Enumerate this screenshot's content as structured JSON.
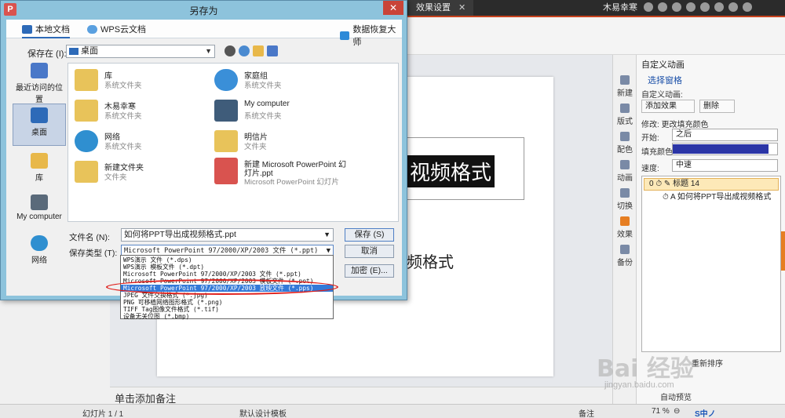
{
  "app": {
    "doc_tab": "效果设置",
    "user": "木易幸寒",
    "canvas_head": [
      "ㅊ",
      "✕",
      "⬚"
    ],
    "slide": {
      "title_text": "视频格式",
      "subtitle_text": "频格式"
    },
    "notes_placeholder": "单击添加备注",
    "status": {
      "slide": "幻灯片 1 / 1",
      "template": "默认设计模板",
      "notes": "备注",
      "zoom": "71 %",
      "ime": "S中ノ"
    },
    "side_tabs": [
      "新建",
      "版式",
      "配色",
      "动画",
      "切换",
      "效果",
      "备份"
    ],
    "taskpane": {
      "title": "自定义动画",
      "select_pane": "选择窗格",
      "custom_anim": "自定义动画:",
      "add_effect": "添加效果",
      "delete": "删除",
      "modify": "修改: 更改填充颜色",
      "start_label": "开始:",
      "start_value": "之后",
      "fill_label": "填充颜色:",
      "speed_label": "速度:",
      "speed_value": "中速",
      "item1": "0  ⏱  ✎  标题 14",
      "item2": "⏱  A  如何将PPT导出成视频格式",
      "bottom_line1": "重新排序",
      "bottom_line2": "自动预览"
    },
    "watermark": "Bai 经验",
    "watermark_sub": "jingyan.baidu.com"
  },
  "dialog": {
    "title": "另存为",
    "logo": "P",
    "close": "✕",
    "tabs": [
      "本地文档",
      "WPS云文档",
      "数据恢复大师"
    ],
    "save_in_label": "保存在 (I):",
    "save_in_value": "桌面",
    "places": [
      "最近访问的位置",
      "桌面",
      "库",
      "My computer",
      "网络"
    ],
    "files": [
      {
        "name": "库",
        "type": "系统文件夹"
      },
      {
        "name": "家庭组",
        "type": "系统文件夹"
      },
      {
        "name": "木易幸寒",
        "type": "系统文件夹"
      },
      {
        "name": "My computer",
        "type": "系统文件夹"
      },
      {
        "name": "网络",
        "type": "系统文件夹"
      },
      {
        "name": "明信片",
        "type": "文件夹"
      },
      {
        "name": "新建文件夹",
        "type": "文件夹"
      },
      {
        "name": "新建 Microsoft PowerPoint 幻",
        "name2": "灯片.ppt",
        "type": "Microsoft PowerPoint 幻灯片"
      }
    ],
    "filename_label": "文件名 (N):",
    "filename_value": "如何将PPT导出成视频格式.ppt",
    "filetype_label": "保存类型 (T):",
    "filetype_value": "Microsoft PowerPoint 97/2000/XP/2003 文件 (*.ppt)",
    "buttons": {
      "save": "保存 (S)",
      "cancel": "取消",
      "encrypt": "加密 (E)..."
    },
    "dropdown_options": [
      "WPS演示 文件 (*.dps)",
      "WPS演示 模板文件 (*.dpt)",
      "Microsoft PowerPoint 97/2000/XP/2003 文件 (*.ppt)",
      "Microsoft PowerPoint 97/2000/XP/2003 模板文件 (*.pot)",
      "Microsoft PowerPoint 97/2000/XP/2003 放映文件 (*.pps)",
      "JPEG 文件交换格式 (*.jpg)",
      "PNG 可移植网络图形格式 (*.png)",
      "TIFF Tag图像文件格式 (*.tif)",
      "设备无关位图 (*.bmp)"
    ],
    "selected_option_index": 4
  },
  "colors": {
    "dialog_frame": "#8dc3dc",
    "selection": "#3379d8",
    "highlight_ellipse": "#e0201c",
    "fill_color": "#2b35a6"
  }
}
